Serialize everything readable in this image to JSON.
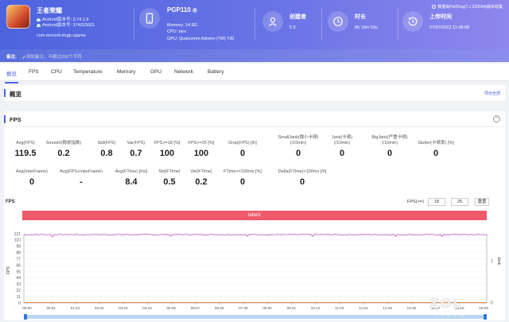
{
  "app": {
    "name": "王者荣耀",
    "android_version": "Android版本号: 3.74.1.6",
    "android_code": "Android版本号: 374010601",
    "package": "com.tencent.tmgp.sgame"
  },
  "device": {
    "name": "PGP110",
    "memory": "Memory: 14.9G",
    "cpu": "CPU: taro",
    "gpu": "GPU: Qualcomm Adreno (TM) 730"
  },
  "creator": {
    "label": "创建者",
    "value": "5 5"
  },
  "duration": {
    "label": "时长",
    "value": "0h 16m 53s"
  },
  "upload_time": {
    "label": "上传时间",
    "value": "27/07/2022 11:48:08"
  },
  "version_text": "数据由PerfDog(7.1.220504)版本收集",
  "notes": {
    "label": "备注:",
    "placeholder": "添加备注，不超过200个字符"
  },
  "tabs": [
    "概览",
    "FPS",
    "CPU",
    "Temperature",
    "Memory",
    "GPU",
    "Network",
    "Battery"
  ],
  "overview": {
    "title": "概览",
    "export_label": "导出全部"
  },
  "fps_panel": {
    "title": "FPS",
    "collapse": "−",
    "row1": [
      {
        "label": "Avg(FPS)",
        "value": "119.5"
      },
      {
        "label": "Smooth(稳帧指数)",
        "value": "0.2"
      },
      {
        "label": "Std(FPS)",
        "value": "0.8"
      },
      {
        "label": "Var(FPS)",
        "value": "0.7"
      },
      {
        "label": "FPS>=18 [%]",
        "value": "100"
      },
      {
        "label": "FPS>=25 [%]",
        "value": "100"
      },
      {
        "label": "Drop(FPS) [/h]",
        "value": "0"
      },
      {
        "label": "SmallJank(微小卡顿)\n(/10min)",
        "value": "0"
      },
      {
        "label": "Jank(卡顿)\n(/10min)",
        "value": "0"
      },
      {
        "label": "BigJank(严重卡顿)\n(/10min)",
        "value": "0"
      },
      {
        "label": "Stutter(卡顿率) [%]",
        "value": "0"
      }
    ],
    "row2": [
      {
        "label": "Avg(InterFrame)",
        "value": "0"
      },
      {
        "label": "Avg(FPS+InterFrame)",
        "value": "-"
      },
      {
        "label": "Avg(FTime) [ms]",
        "value": "8.4"
      },
      {
        "label": "Std(FTime)",
        "value": "0.5"
      },
      {
        "label": "Var(FTime)",
        "value": "0.2"
      },
      {
        "label": "FTime>=100ms [%]",
        "value": "0"
      },
      {
        "label": "Delta(FTime)>100ms [/h]",
        "value": "0"
      }
    ]
  },
  "chart_controls": {
    "title": "FPS",
    "fps_ge_label": "FPS(>=)",
    "fps_threshold_1": "18",
    "fps_threshold_2": "25",
    "reset_label": "重置"
  },
  "chart_data": {
    "type": "line",
    "label_band": "label1",
    "ylabel": "FPS",
    "ylabel_right": "Jank",
    "y_ticks": [
      "121",
      "110",
      "99",
      "88",
      "77",
      "66",
      "55",
      "44",
      "33",
      "22",
      "11",
      "0"
    ],
    "x_ticks": [
      "00:00",
      "00:51",
      "01:42",
      "02:33",
      "03:24",
      "04:15",
      "05:06",
      "05:57",
      "06:48",
      "07:39",
      "08:30",
      "09:21",
      "10:12",
      "11:03",
      "11:54",
      "12:45",
      "13:36",
      "14:27",
      "15:18",
      "16:09"
    ],
    "ylim": [
      0,
      121
    ],
    "series": [
      {
        "color": "#b83dba",
        "baseline": 119.5,
        "low_dips": [
          115.5,
          116,
          116.5
        ],
        "description_values": "approximately constant around 119.5 FPS with small dips"
      },
      {
        "color": "#e07a2e",
        "baseline": 0
      }
    ],
    "right_ticks": [
      "1",
      "0"
    ]
  },
  "watermark": {
    "main": "ZOL",
    "sub": "中关村在线"
  }
}
